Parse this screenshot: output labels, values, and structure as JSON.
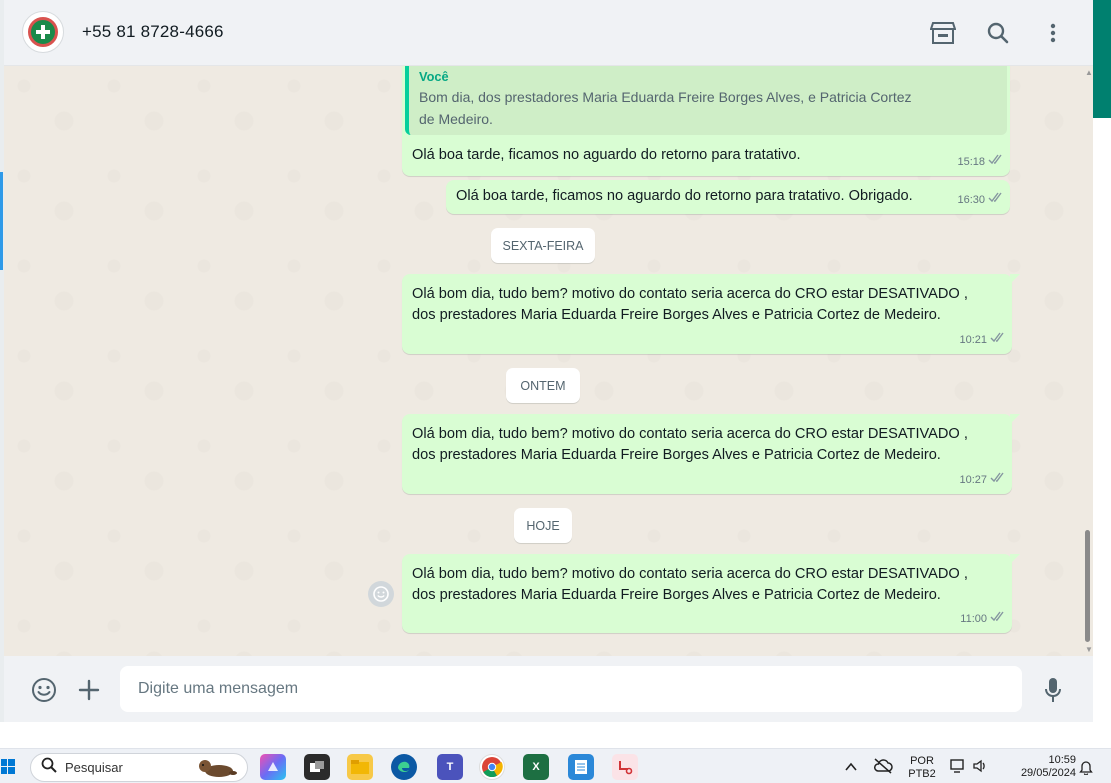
{
  "header": {
    "contact_name": "+55 81 8728-4666",
    "icons": [
      "catalog-store-icon",
      "search-icon",
      "menu-kebab-icon"
    ]
  },
  "messages": [
    {
      "quoted": {
        "author": "Você",
        "text": "Bom dia, dos prestadores Maria Eduarda Freire Borges Alves, e Patricia Cortez\nde Medeiro."
      },
      "text": "Olá boa tarde, ficamos no aguardo do retorno para tratativo.",
      "time": "15:18",
      "status": "read"
    },
    {
      "text": "Olá boa tarde, ficamos no aguardo do retorno para tratativo. Obrigado.",
      "time": "16:30",
      "status": "read"
    },
    {
      "text": "Olá bom dia, tudo bem? motivo do contato seria acerca do CRO estar DESATIVADO ,\ndos prestadores Maria Eduarda Freire Borges Alves e Patricia Cortez de Medeiro.",
      "time": "10:21",
      "status": "read"
    },
    {
      "text": "Olá bom dia, tudo bem? motivo do contato seria acerca do CRO estar DESATIVADO ,\ndos prestadores Maria Eduarda Freire Borges Alves e Patricia Cortez de Medeiro.",
      "time": "10:27",
      "status": "read"
    },
    {
      "text": "Olá bom dia, tudo bem? motivo do contato seria acerca do CRO estar DESATIVADO ,\ndos prestadores Maria Eduarda Freire Borges Alves e Patricia Cortez de Medeiro.",
      "time": "11:00",
      "status": "read"
    }
  ],
  "day_separators": [
    "SEXTA-FEIRA",
    "ONTEM",
    "HOJE"
  ],
  "composer": {
    "placeholder": "Digite uma mensagem",
    "icons": [
      "emoji-icon",
      "plus-icon",
      "microphone-icon"
    ]
  },
  "taskbar": {
    "search_label": "Pesquisar",
    "apps": [
      "copilot-app",
      "task-view-app",
      "file-explorer-app",
      "edge-app",
      "teams-app",
      "chrome-app",
      "excel-app",
      "notepad-app",
      "snipping-tool-app"
    ],
    "language": "POR",
    "keyboard": "PTB2",
    "time": "10:59",
    "date": "29/05/2024"
  },
  "colors": {
    "outgoing_bubble": "#d9fdd3",
    "chat_background": "#efeae2",
    "header_background": "#f0f2f5",
    "quote_accent": "#06cf9c",
    "read_ticks": "#667781"
  }
}
